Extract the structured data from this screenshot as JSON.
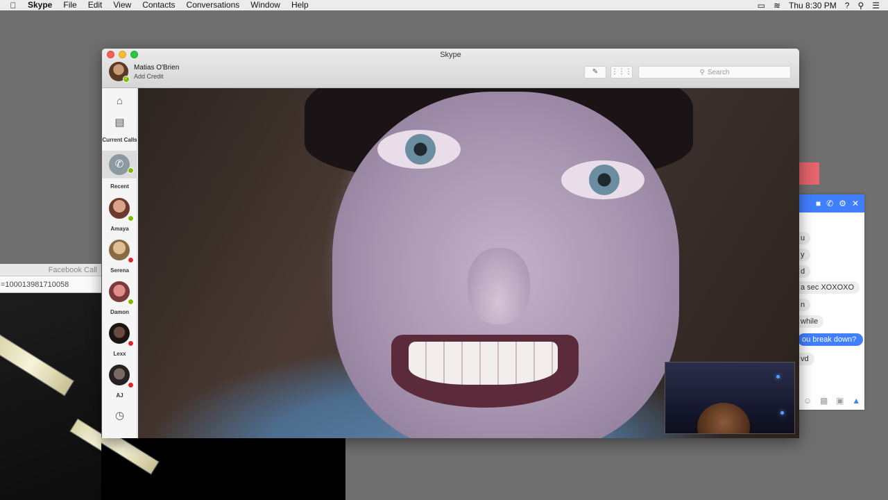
{
  "menubar": {
    "app": "Skype",
    "items": [
      "File",
      "Edit",
      "View",
      "Contacts",
      "Conversations",
      "Window",
      "Help"
    ],
    "clock": "Thu 8:30 PM",
    "help_icon": "?"
  },
  "facebook_call": {
    "title": "Facebook Call",
    "url": "=100013981710058"
  },
  "messenger": {
    "messages": [
      "u",
      "y",
      "d",
      "a sec XOXOXO",
      "n",
      "while",
      "ou break down?",
      "vd"
    ]
  },
  "skype": {
    "window_title": "Skype",
    "profile": {
      "name": "Matias O'Brien",
      "credit": "Add Credit"
    },
    "search_placeholder": "Search",
    "sidebar": {
      "current_calls_label": "Current Calls",
      "recent_label": "Recent",
      "contacts": [
        {
          "name": "Amaya",
          "status": "online",
          "color": "#b06a58"
        },
        {
          "name": "Serena",
          "status": "busy",
          "color": "#c19a72"
        },
        {
          "name": "Damon",
          "status": "online",
          "color": "#b66e6e"
        },
        {
          "name": "Lexx",
          "status": "busy",
          "color": "#3a2a26"
        },
        {
          "name": "AJ",
          "status": "busy",
          "color": "#4a4646"
        }
      ]
    }
  },
  "colors": {
    "skype_status_online": "#7fba00",
    "skype_status_busy": "#e0242c",
    "messenger_blue": "#4080ff"
  }
}
